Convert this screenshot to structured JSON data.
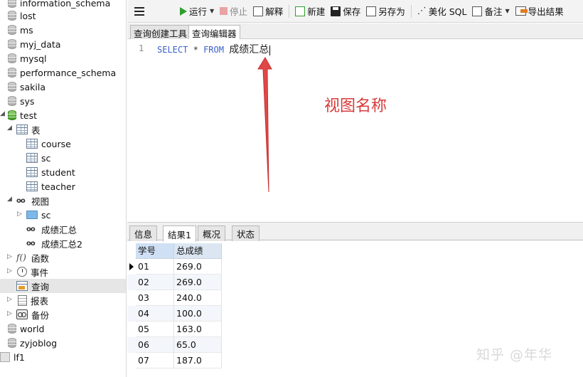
{
  "sidebar": {
    "items": [
      {
        "label": "information_schema",
        "icon": "database-icon"
      },
      {
        "label": "lost",
        "icon": "database-icon"
      },
      {
        "label": "ms",
        "icon": "database-icon"
      },
      {
        "label": "myj_data",
        "icon": "database-icon"
      },
      {
        "label": "mysql",
        "icon": "database-icon"
      },
      {
        "label": "performance_schema",
        "icon": "database-icon"
      },
      {
        "label": "sakila",
        "icon": "database-icon"
      },
      {
        "label": "sys",
        "icon": "database-icon"
      },
      {
        "label": "test",
        "icon": "database-open-icon"
      },
      {
        "label": "表",
        "icon": "tables-icon"
      },
      {
        "label": "course",
        "icon": "table-icon"
      },
      {
        "label": "sc",
        "icon": "table-icon"
      },
      {
        "label": "student",
        "icon": "table-icon"
      },
      {
        "label": "teacher",
        "icon": "table-icon"
      },
      {
        "label": "视图",
        "icon": "views-icon"
      },
      {
        "label": "sc",
        "icon": "folder-icon"
      },
      {
        "label": "成绩汇总",
        "icon": "view-icon"
      },
      {
        "label": "成绩汇总2",
        "icon": "view-icon"
      },
      {
        "label": "函数",
        "icon": "function-icon"
      },
      {
        "label": "事件",
        "icon": "event-icon"
      },
      {
        "label": "查询",
        "icon": "query-icon"
      },
      {
        "label": "报表",
        "icon": "report-icon"
      },
      {
        "label": "备份",
        "icon": "backup-icon"
      },
      {
        "label": "world",
        "icon": "database-icon"
      },
      {
        "label": "zyjoblog",
        "icon": "database-icon"
      },
      {
        "label": "lf1",
        "icon": "connection-icon"
      }
    ]
  },
  "toolbar": {
    "run": "运行",
    "stop": "停止",
    "explain": "解释",
    "new": "新建",
    "save": "保存",
    "save_as": "另存为",
    "beautify": "美化 SQL",
    "note": "备注",
    "export": "导出结果"
  },
  "editor_tabs": [
    "查询创建工具",
    "查询编辑器"
  ],
  "editor": {
    "line_number": "1",
    "kw_select": "SELECT",
    "star": "*",
    "kw_from": "FROM",
    "view_name": "成绩汇总"
  },
  "annotation": "视图名称",
  "result_tabs": [
    "信息",
    "结果1",
    "概况",
    "状态"
  ],
  "grid": {
    "columns": [
      "学号",
      "总成绩"
    ],
    "rows": [
      [
        "01",
        "269.0"
      ],
      [
        "02",
        "269.0"
      ],
      [
        "03",
        "240.0"
      ],
      [
        "04",
        "100.0"
      ],
      [
        "05",
        "163.0"
      ],
      [
        "06",
        "65.0"
      ],
      [
        "07",
        "187.0"
      ]
    ]
  },
  "watermark": "知乎 @年华",
  "colors": {
    "annotation": "#d73a3a",
    "keyword": "#3a5fcd",
    "run_icon": "#2e9e2e"
  }
}
